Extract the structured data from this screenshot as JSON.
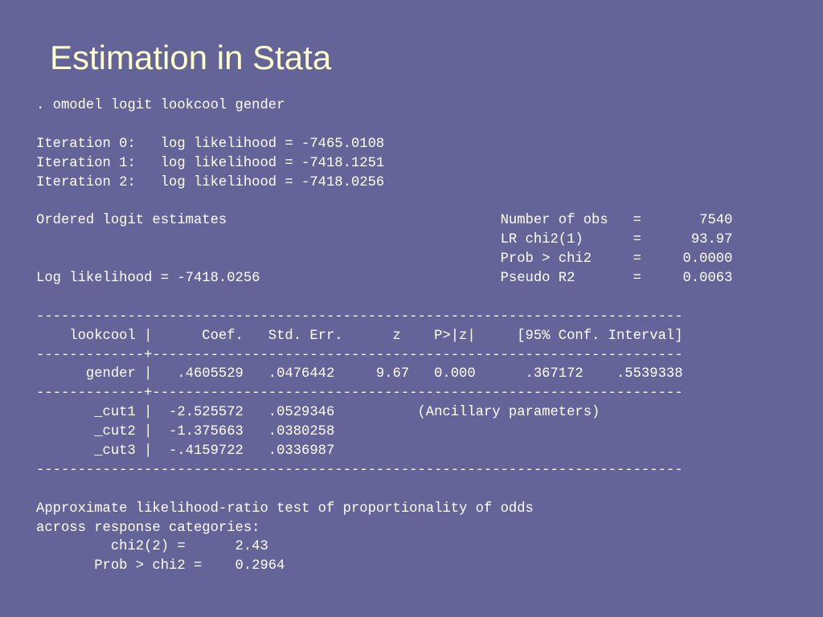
{
  "slide": {
    "title": "Estimation in Stata"
  },
  "colors": {
    "background": "#646499",
    "title": "#ffffcc",
    "body_text": "#ffffff"
  },
  "output_lines": [
    ". omodel logit lookcool gender",
    "",
    "Iteration 0:   log likelihood = -7465.0108",
    "Iteration 1:   log likelihood = -7418.1251",
    "Iteration 2:   log likelihood = -7418.0256",
    "",
    "Ordered logit estimates                                 Number of obs   =       7540",
    "                                                        LR chi2(1)      =      93.97",
    "                                                        Prob > chi2     =     0.0000",
    "Log likelihood = -7418.0256                             Pseudo R2       =     0.0063",
    "",
    "------------------------------------------------------------------------------",
    "    lookcool |      Coef.   Std. Err.      z    P>|z|     [95% Conf. Interval]",
    "-------------+----------------------------------------------------------------",
    "      gender |   .4605529   .0476442     9.67   0.000      .367172    .5539338",
    "-------------+----------------------------------------------------------------",
    "       _cut1 |  -2.525572   .0529346          (Ancillary parameters)",
    "       _cut2 |  -1.375663   .0380258",
    "       _cut3 |  -.4159722   .0336987",
    "------------------------------------------------------------------------------",
    "",
    "Approximate likelihood-ratio test of proportionality of odds",
    "across response categories:",
    "         chi2(2) =      2.43",
    "       Prob > chi2 =    0.2964"
  ]
}
